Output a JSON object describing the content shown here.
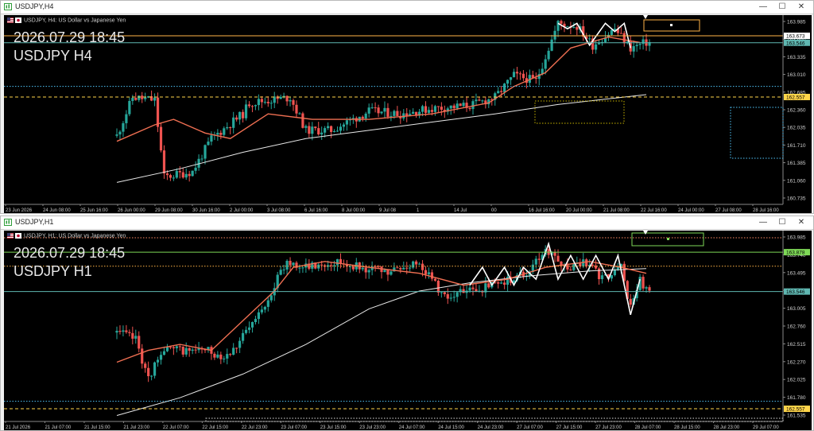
{
  "windows": [
    {
      "id": "h4",
      "title": "USDJPY,H4",
      "symbol_desc": "USDJPY, H4:  US Dollar vs Japanese Yen",
      "overlay_date": "2026.07.29 18:45",
      "overlay_symbol": "USDJPY H4",
      "controls": {
        "minimize": "—",
        "maximize": "☐",
        "close": "✕"
      },
      "price_labels": [
        "163.985",
        "163.660",
        "163.335",
        "163.010",
        "162.685",
        "162.360",
        "162.035",
        "161.710",
        "161.385",
        "161.060",
        "160.735"
      ],
      "price_range": [
        160.6,
        164.05
      ],
      "tags": [
        {
          "text": "163.673",
          "price": 163.673,
          "color": "#ffffff"
        },
        {
          "text": "163.546",
          "price": 163.546,
          "color": "#5fb7b1"
        },
        {
          "text": "162.557",
          "price": 162.557,
          "color": "#ffd54a"
        }
      ],
      "time_labels": [
        "23 Jun 2026",
        "24 Jun 08:00",
        "25 Jun 16:00",
        "26 Jun 00:00",
        "29 Jun 08:00",
        "30 Jun 16:00",
        "2 Jul 00:00",
        "3 Jul 08:00",
        "6 Jul 16:00",
        "8 Jul 00:00",
        "9 Jul 08",
        "1",
        "14 Jul",
        "00",
        "16 Jul 16:00",
        "20 Jul 00:00",
        "21 Jul 08:00",
        "22 Jul 16:00",
        "24 Jul 00:00",
        "27 Jul 08:00",
        "28 Jul 16:00"
      ]
    },
    {
      "id": "h1",
      "title": "USDJPY,H1",
      "symbol_desc": "USDJPY, H1:  US Dollar vs Japanese Yen",
      "overlay_date": "2026.07.29 18:45",
      "overlay_symbol": "USDJPY H1",
      "controls": {
        "minimize": "—",
        "maximize": "☐",
        "close": "✕"
      },
      "price_labels": [
        "163.985",
        "163.740",
        "163.495",
        "163.250",
        "163.005",
        "162.760",
        "162.515",
        "162.270",
        "162.025",
        "161.780",
        "161.535"
      ],
      "price_range": [
        162.45,
        164.06
      ],
      "tags": [
        {
          "text": "163.878",
          "price": 163.878,
          "color": "#7ed957"
        },
        {
          "text": "163.546",
          "price": 163.546,
          "color": "#5fb7b1"
        },
        {
          "text": "162.557",
          "price": 162.557,
          "color": "#ffd54a"
        }
      ],
      "time_labels": [
        "21 Jul 2026",
        "21 Jul 07:00",
        "21 Jul 15:00",
        "21 Jul 23:00",
        "22 Jul 07:00",
        "22 Jul 15:00",
        "22 Jul 23:00",
        "23 Jul 07:00",
        "23 Jul 15:00",
        "23 Jul 23:00",
        "24 Jul 07:00",
        "24 Jul 15:00",
        "24 Jul 23:00",
        "27 Jul 07:00",
        "27 Jul 15:00",
        "27 Jul 23:00",
        "28 Jul 07:00",
        "28 Jul 15:00",
        "28 Jul 23:00",
        "29 Jul 07:00"
      ]
    }
  ],
  "colors": {
    "background": "#000000",
    "bull": "#26a69a",
    "bear": "#ef5350",
    "ma_fast": "#ef6f52",
    "ma_slow": "#e8e8e8",
    "zigzag": "#ffffff",
    "level_orange": "#ffb347",
    "level_cyan": "#4fc3f7",
    "level_yellow": "#ffd54a",
    "level_green": "#7ed957"
  },
  "chart_data": [
    {
      "type": "candlestick",
      "timeframe": "H4",
      "anchors": [
        [
          0,
          161.85
        ],
        [
          5,
          162.55
        ],
        [
          12,
          162.5
        ],
        [
          15,
          161.1
        ],
        [
          24,
          161.2
        ],
        [
          30,
          161.8
        ],
        [
          40,
          162.25
        ],
        [
          42,
          162.45
        ],
        [
          55,
          162.55
        ],
        [
          60,
          161.95
        ],
        [
          68,
          161.95
        ],
        [
          80,
          162.3
        ],
        [
          90,
          162.25
        ],
        [
          100,
          162.35
        ],
        [
          112,
          162.4
        ],
        [
          120,
          162.55
        ],
        [
          126,
          162.95
        ],
        [
          133,
          162.85
        ],
        [
          140,
          163.9
        ],
        [
          146,
          163.85
        ],
        [
          151,
          163.5
        ],
        [
          158,
          163.8
        ],
        [
          163,
          163.45
        ],
        [
          168,
          163.55
        ]
      ],
      "ma_fast": [
        [
          0,
          161.75
        ],
        [
          12,
          162.05
        ],
        [
          18,
          162.15
        ],
        [
          28,
          161.9
        ],
        [
          36,
          161.8
        ],
        [
          48,
          162.25
        ],
        [
          62,
          162.15
        ],
        [
          80,
          162.15
        ],
        [
          100,
          162.25
        ],
        [
          118,
          162.45
        ],
        [
          126,
          162.75
        ],
        [
          136,
          163.0
        ],
        [
          144,
          163.45
        ],
        [
          156,
          163.65
        ],
        [
          166,
          163.55
        ]
      ],
      "ma_slow": [
        [
          0,
          161.0
        ],
        [
          20,
          161.25
        ],
        [
          40,
          161.55
        ],
        [
          60,
          161.8
        ],
        [
          80,
          161.95
        ],
        [
          100,
          162.1
        ],
        [
          120,
          162.25
        ],
        [
          140,
          162.42
        ],
        [
          160,
          162.55
        ],
        [
          168,
          162.6
        ]
      ],
      "zigzag": [
        [
          140,
          163.9
        ],
        [
          143,
          163.8
        ],
        [
          146,
          163.9
        ],
        [
          150,
          163.5
        ],
        [
          155,
          163.9
        ],
        [
          158,
          163.75
        ],
        [
          161,
          163.9
        ],
        [
          163,
          163.45
        ]
      ],
      "levels": [
        {
          "price": 163.673,
          "style": "solid",
          "color": "#ffb347"
        },
        {
          "price": 163.546,
          "style": "solid",
          "color": "#5fb7b1"
        },
        {
          "price": 162.557,
          "style": "dashed",
          "color": "#ffd54a"
        },
        {
          "price": 162.75,
          "style": "dotted",
          "color": "#4fc3f7"
        }
      ]
    },
    {
      "type": "candlestick",
      "timeframe": "H1",
      "anchors": [
        [
          0,
          163.2
        ],
        [
          6,
          163.15
        ],
        [
          10,
          162.8
        ],
        [
          14,
          163.05
        ],
        [
          28,
          163.05
        ],
        [
          34,
          163.0
        ],
        [
          38,
          163.1
        ],
        [
          44,
          163.3
        ],
        [
          50,
          163.6
        ],
        [
          54,
          163.8
        ],
        [
          60,
          163.75
        ],
        [
          70,
          163.8
        ],
        [
          78,
          163.75
        ],
        [
          86,
          163.7
        ],
        [
          96,
          163.8
        ],
        [
          104,
          163.5
        ],
        [
          112,
          163.55
        ],
        [
          120,
          163.6
        ],
        [
          130,
          163.7
        ],
        [
          136,
          163.9
        ],
        [
          142,
          163.75
        ],
        [
          150,
          163.8
        ],
        [
          154,
          163.65
        ],
        [
          160,
          163.75
        ],
        [
          163,
          163.4
        ],
        [
          166,
          163.65
        ],
        [
          168,
          163.55
        ]
      ],
      "ma_fast": [
        [
          0,
          162.95
        ],
        [
          10,
          163.05
        ],
        [
          20,
          163.1
        ],
        [
          30,
          163.05
        ],
        [
          40,
          163.3
        ],
        [
          50,
          163.55
        ],
        [
          56,
          163.75
        ],
        [
          66,
          163.8
        ],
        [
          80,
          163.75
        ],
        [
          96,
          163.7
        ],
        [
          110,
          163.6
        ],
        [
          124,
          163.65
        ],
        [
          136,
          163.75
        ],
        [
          150,
          163.8
        ],
        [
          160,
          163.75
        ],
        [
          168,
          163.7
        ]
      ],
      "ma_slow": [
        [
          0,
          162.5
        ],
        [
          20,
          162.65
        ],
        [
          40,
          162.85
        ],
        [
          60,
          163.1
        ],
        [
          80,
          163.4
        ],
        [
          96,
          163.55
        ],
        [
          112,
          163.62
        ],
        [
          132,
          163.68
        ],
        [
          150,
          163.72
        ],
        [
          168,
          163.74
        ]
      ],
      "zigzag": [
        [
          112,
          163.6
        ],
        [
          116,
          163.75
        ],
        [
          119,
          163.6
        ],
        [
          123,
          163.75
        ],
        [
          126,
          163.6
        ],
        [
          129,
          163.75
        ],
        [
          133,
          163.65
        ],
        [
          137,
          163.95
        ],
        [
          140,
          163.65
        ],
        [
          144,
          163.85
        ],
        [
          148,
          163.65
        ],
        [
          152,
          163.85
        ],
        [
          156,
          163.65
        ],
        [
          159,
          163.85
        ],
        [
          163,
          163.35
        ],
        [
          166,
          163.65
        ]
      ],
      "levels": [
        {
          "price": 163.878,
          "style": "solid",
          "color": "#7ed957"
        },
        {
          "price": 163.546,
          "style": "solid",
          "color": "#5fb7b1"
        },
        {
          "price": 163.76,
          "style": "dotted",
          "color": "#ffb347"
        },
        {
          "price": 162.62,
          "style": "dotted",
          "color": "#4fc3f7"
        },
        {
          "price": 162.557,
          "style": "dashed",
          "color": "#ffd54a"
        },
        {
          "price": 164.0,
          "style": "dotted",
          "color": "#ff8a65"
        }
      ]
    }
  ]
}
